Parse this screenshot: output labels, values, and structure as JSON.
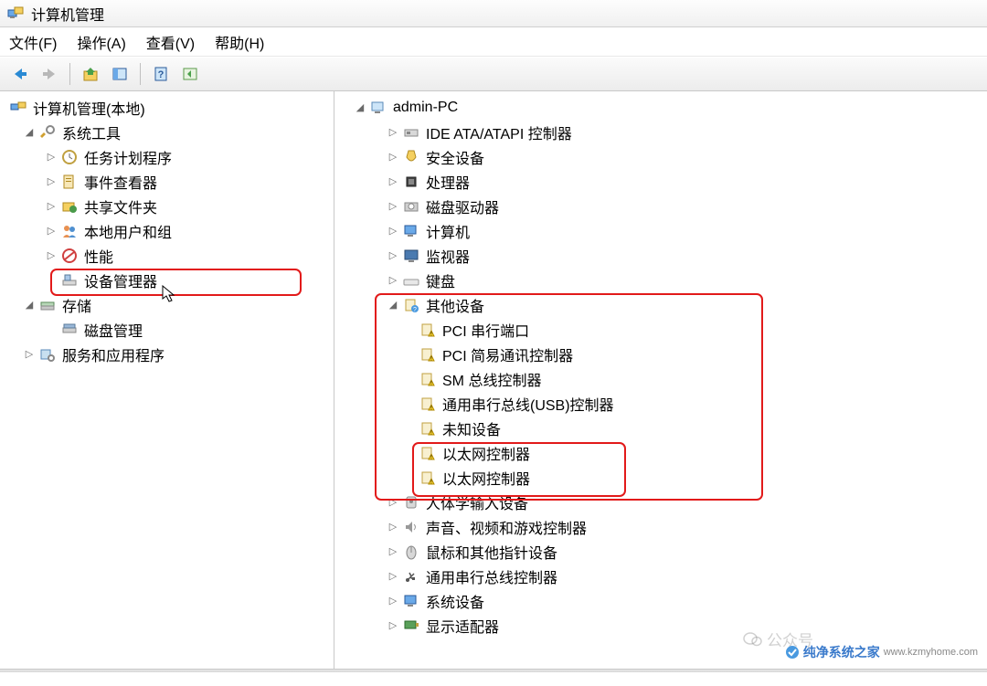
{
  "window": {
    "title": "计算机管理"
  },
  "menu": {
    "file": "文件(F)",
    "action": "操作(A)",
    "view": "查看(V)",
    "help": "帮助(H)"
  },
  "left_tree": {
    "root": "计算机管理(本地)",
    "sys_tools": "系统工具",
    "task_sched": "任务计划程序",
    "event_viewer": "事件查看器",
    "shared": "共享文件夹",
    "local_users": "本地用户和组",
    "perf": "性能",
    "devmgr": "设备管理器",
    "storage": "存储",
    "diskmgmt": "磁盘管理",
    "services": "服务和应用程序"
  },
  "right_tree": {
    "root": "admin-PC",
    "ide": "IDE ATA/ATAPI 控制器",
    "security": "安全设备",
    "cpu": "处理器",
    "diskdrive": "磁盘驱动器",
    "computer": "计算机",
    "monitor": "监视器",
    "keyboard": "键盘",
    "other": "其他设备",
    "pci_serial": "PCI 串行端口",
    "pci_comm": "PCI 简易通讯控制器",
    "sm_bus": "SM 总线控制器",
    "usb_ctrl": "通用串行总线(USB)控制器",
    "unknown": "未知设备",
    "eth1": "以太网控制器",
    "eth2": "以太网控制器",
    "hid": "人体学输入设备",
    "sound": "声音、视频和游戏控制器",
    "mouse": "鼠标和其他指针设备",
    "usb_hub": "通用串行总线控制器",
    "system": "系统设备",
    "display": "显示适配器"
  },
  "watermark": {
    "w1": "公众号",
    "w2": "纯净系统之家",
    "w3": "www.kzmyhome.com"
  }
}
